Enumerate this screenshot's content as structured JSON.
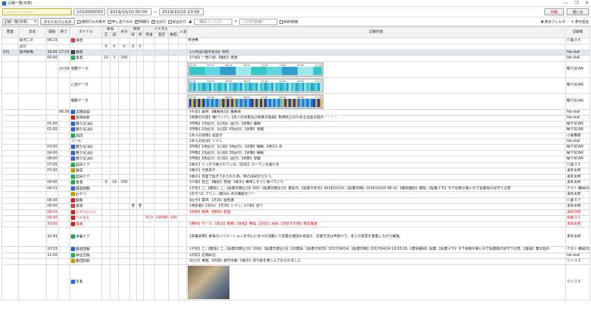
{
  "window": {
    "title": "記録一覧(日常)"
  },
  "toolbar1": {
    "facility": "……………………",
    "facility_code": "1010000000",
    "date_from": "2019/10/10 00:00",
    "tilde": "~",
    "date_to": "2019/10/10 23:59",
    "print_label": "印刷",
    "close_label": "閉じる"
  },
  "toolbar2": {
    "view_select": "記録一覧(日常)",
    "title_filter_label": "タイトルフィルタ",
    "cb_selected": "選択行のみ表示",
    "cb_handover": "申し送りのみ",
    "cb_detail": "明細行",
    "cb_total": "合計行",
    "cb_summary": "総合計行",
    "staff_placeholder": "（職員フィルタ）",
    "text_placeholder": "（文字列検索）",
    "cb_and": "AND検索",
    "display_filter": "表示フィルタ",
    "display_settings": "表示設定"
  },
  "headers": {
    "room": "居室",
    "name": "氏名",
    "start": "開始",
    "end": "終了",
    "title": "タイトル",
    "meal": "食事",
    "main": "主",
    "side": "副",
    "water": "水分",
    "excretion": "排泄",
    "urine": "尿",
    "stool": "便",
    "vitals": "バイタル",
    "temp": "体温",
    "bp": "血圧",
    "pulse": "脈拍",
    "bath": "入浴",
    "content": "記録内容",
    "recorder": "記録者"
  },
  "rows": [
    {
      "room": "",
      "name": "駿河二子",
      "start": "08:23",
      "end": "",
      "title": "排泄",
      "icon": "#c44",
      "main": "",
      "side": "",
      "water": "",
      "urine": "",
      "stool": "",
      "temp": "",
      "bp": "",
      "pulse": "",
      "bath": "",
      "content": "排泄無",
      "rec": "介護 0 5",
      "red": false
    },
    {
      "room": "",
      "name": "合計",
      "start": "",
      "end": "",
      "title": "",
      "icon": "",
      "main": "0",
      "side": "0",
      "water": "0",
      "urine": "0",
      "stool": "0",
      "temp": "",
      "bp": "",
      "pulse": "",
      "bath": "",
      "content": "",
      "rec": "",
      "red": false
    },
    {
      "room": "101",
      "name": "駿河秋美",
      "start": "16:50",
      "end": "17:23",
      "title": "異常",
      "icon": "#444",
      "main": "",
      "side": "",
      "water": "",
      "urine": "",
      "stool": "",
      "temp": "",
      "bp": "",
      "pulse": "",
      "bath": "",
      "content": "【入所(尿)指示状況】帰宅",
      "rec": "fds-staf",
      "red": false,
      "sel": true
    },
    {
      "room": "",
      "name": "",
      "start": "00:00",
      "end": "",
      "title": "食事",
      "icon": "#2a5",
      "main": "10",
      "side": "2",
      "water": "100",
      "urine": "",
      "stool": "",
      "temp": "",
      "bp": "",
      "pulse": "",
      "bath": "",
      "content": "【介助】一部介助,【種別】普通",
      "rec": "fds-staf",
      "red": false
    },
    {
      "room": "",
      "name": "",
      "start": "",
      "end": "23:59",
      "title": "体動データ",
      "icon": "",
      "chart": true,
      "content": "",
      "rec": "眠りSCAN",
      "red": false
    },
    {
      "room": "",
      "name": "",
      "start": "",
      "end": "",
      "title": "心拍データ",
      "icon": "",
      "chart": true,
      "content": "",
      "rec": "眠りSCAN",
      "red": false
    },
    {
      "room": "",
      "name": "",
      "start": "",
      "end": "",
      "title": "睡眠データ",
      "icon": "",
      "chart": true,
      "content": "",
      "rec": "眠りSCAN",
      "red": false
    },
    {
      "room": "",
      "name": "",
      "start": "",
      "end": "08:39",
      "title": "定期巡視",
      "icon": "#36c",
      "content": "【午前】異常,【睡眠状況】睡眠良",
      "rec": "fds-staf",
      "red": false
    },
    {
      "room": "",
      "name": "",
      "start": "",
      "end": "",
      "title": "身体拘束",
      "icon": "#c22",
      "content": "【拘束の内容】柵(ベッド),【本人の状態及び拘束の理由】転倒防止のため主治医の指示・・・・",
      "rec": "fds-staf",
      "red": false
    },
    {
      "room": "",
      "name": "",
      "start": "01:00",
      "end": "",
      "title": "眠りSCAN",
      "icon": "#36c",
      "content": "【呼吸】15回/分,【心拍】-回/分,【状態】睡眠",
      "rec": "眠りSCAN",
      "red": false
    },
    {
      "room": "",
      "name": "",
      "start": "02:00",
      "end": "",
      "title": "眠りSCAN",
      "icon": "#36c",
      "content": "【呼吸】15回/分,【心拍】63回/分,【状態】覚醒",
      "rec": "眠りSCAN",
      "red": false
    },
    {
      "room": "",
      "name": "",
      "start": "",
      "end": "",
      "title": "巡回",
      "icon": "#2a5",
      "content": "【本人の状態】寝返り",
      "rec": "小宮舞樹",
      "red": false
    },
    {
      "room": "",
      "name": "",
      "start": "",
      "end": "",
      "title": "コール",
      "icon": "",
      "content": "【本人の状況】トイレ",
      "rec": "fds-staf",
      "red": false
    },
    {
      "room": "",
      "name": "",
      "start": "03:00",
      "end": "",
      "title": "眠りSCAN",
      "icon": "#36c",
      "content": "【呼吸】14回/分,【心拍】34回/分,【状態】睡眠,【様子】あ",
      "rec": "眠りSCAN",
      "red": false
    },
    {
      "room": "",
      "name": "",
      "start": "04:00",
      "end": "",
      "title": "眠りSCAN",
      "icon": "#36c",
      "content": "【呼吸】15回/分,【心拍】55回/分,【状態】睡眠",
      "rec": "眠りSCAN",
      "red": false
    },
    {
      "room": "",
      "name": "",
      "start": "06:00",
      "end": "",
      "title": "眠りSCAN",
      "icon": "#36c",
      "content": "【呼吸】18回/分,【心拍】-回/分,【状態】覚醒",
      "rec": "眠りSCAN",
      "red": false
    },
    {
      "room": "",
      "name": "",
      "start": "07:00",
      "end": "",
      "title": "起床ケア",
      "icon": "#2a5",
      "content": "【様子】ぐっすり眠られている,【対応】カーテンを開ける",
      "rec": "介護 1 0",
      "red": false
    },
    {
      "room": "",
      "name": "",
      "start": "07:30",
      "end": "",
      "title": "整容",
      "icon": "#c90",
      "content": "【様子】元気あり",
      "rec": "湯本太郎",
      "red": false
    },
    {
      "room": "",
      "name": "",
      "start": "",
      "end": "",
      "title": "起床ケア",
      "icon": "#2a5",
      "content": "【様子】自室で起きておられた為、顔の清拭を行なう。",
      "rec": "湯本太郎",
      "red": false
    },
    {
      "room": "",
      "name": "",
      "start": "08:00",
      "end": "",
      "title": "食事",
      "icon": "#2a5",
      "main": "9",
      "side": "10",
      "water": "150",
      "content": "【介助】自立,【種別】普通,【様子】美味しそうに食べていた",
      "rec": "湯本太郎",
      "red": false
    },
    {
      "room": "",
      "name": "",
      "start": "08:15",
      "end": "",
      "title": "経過情報",
      "icon": "#36c",
      "content": "【予定】こ,【薬情】こ,【投薬日数区分】500,【投薬日数区分】薬投与,【投薬予定日】2018/10/10,【投薬日時】2018/10/10 08:15,【薬情種別】薬情,【投薬メモ】今下状態が悪いので投薬後の見守り注意",
      "rec": "テスト 職員01",
      "red": false
    },
    {
      "room": "",
      "name": "",
      "start": "",
      "end": "",
      "title": "おやつ",
      "icon": "#c90",
      "content": "【おやつ】プリン,【飲み】水分補給ゼリー",
      "rec": "湯本太郎",
      "red": false
    },
    {
      "room": "",
      "name": "",
      "start": "08:30",
      "end": "",
      "title": "服薬",
      "icon": "#c22",
      "content": "【区分】薬済,【方法】個包装",
      "rec": "介護 0 7",
      "red": false
    },
    {
      "room": "",
      "name": "",
      "start": "09:00",
      "end": "",
      "title": "排泄",
      "icon": "#c44",
      "urine": "普",
      "stool": "普",
      "content": "【排尿量】150cc,【方法】トイレ,【介助】全介",
      "rec": "湯本太郎",
      "red": false
    },
    {
      "room": "",
      "name": "",
      "start": "09:15",
      "end": "",
      "title": "ヒヤリハット",
      "icon": "#c22",
      "content": "【状態】転倒,【場所】居室",
      "rec": "湯本次郎",
      "red": true
    },
    {
      "room": "",
      "name": "",
      "start": "09:30",
      "end": "",
      "title": "バイタル",
      "icon": "#c22",
      "temp": "37.0",
      "bp": "120/80",
      "pulse": "100",
      "content": "",
      "rec": "看護 1 1",
      "red": true
    },
    {
      "room": "",
      "name": "",
      "start": "10:00",
      "end": "",
      "title": "事故",
      "icon": "#c22",
      "content": "【場所】ホール,【状況】転倒,【受傷】擦傷,【対応】消毒,【対応その他】救急搬送",
      "rec": "湯本太郎",
      "red": true
    },
    {
      "room": "",
      "name": "",
      "start": "10:43",
      "end": "",
      "title": "栄養ケア",
      "icon": "#2a5",
      "content": "【栄養状態】食事のバリエーションを中心に日々の活動にて体重の増加を目指す。支援方法は声掛けで、本人の意思を尊重しながら実施。",
      "rec": "湯本太郎",
      "red": false,
      "tall": true
    },
    {
      "room": "",
      "name": "",
      "start": "10:53",
      "end": "",
      "title": "経過情報",
      "icon": "#36c",
      "content": "【予定】こ,【薬情】こ,【投薬日数区分】1000,【投薬日数区分】1日薬投,【投薬予定日】2017/04/24,【投薬日時】2017/04/24 10:53:19,【薬情種別】投薬,【投薬メモ】今下状態が悪いので投薬後の見守り注意,【理由】薬の指示",
      "rec": "テスト 職員01",
      "red": false
    },
    {
      "room": "",
      "name": "",
      "start": "11:00",
      "end": "",
      "title": "体位交換",
      "icon": "#2a5",
      "content": "【対応】右側臥位",
      "rec": "fds-staf",
      "red": false
    },
    {
      "room": "",
      "name": "",
      "start": "",
      "end": "",
      "title": "集団回想",
      "icon": "#c90",
      "content": "【区分】実施,【内容】創作活動,【様子】切り絵を楽しんでおられました",
      "rec": "リハ 1 3",
      "red": false
    },
    {
      "room": "",
      "name": "",
      "start": "",
      "end": "",
      "title": "写真",
      "icon": "#36c",
      "photo": true,
      "content": "",
      "rec": "リハ 1 3",
      "red": false
    }
  ],
  "chart_axis": [
    "00:00",
    "03:00",
    "06:00",
    "09:00",
    "12:00",
    "15:00",
    "18:00",
    "21:00"
  ],
  "chart_date": "2019/10/10"
}
